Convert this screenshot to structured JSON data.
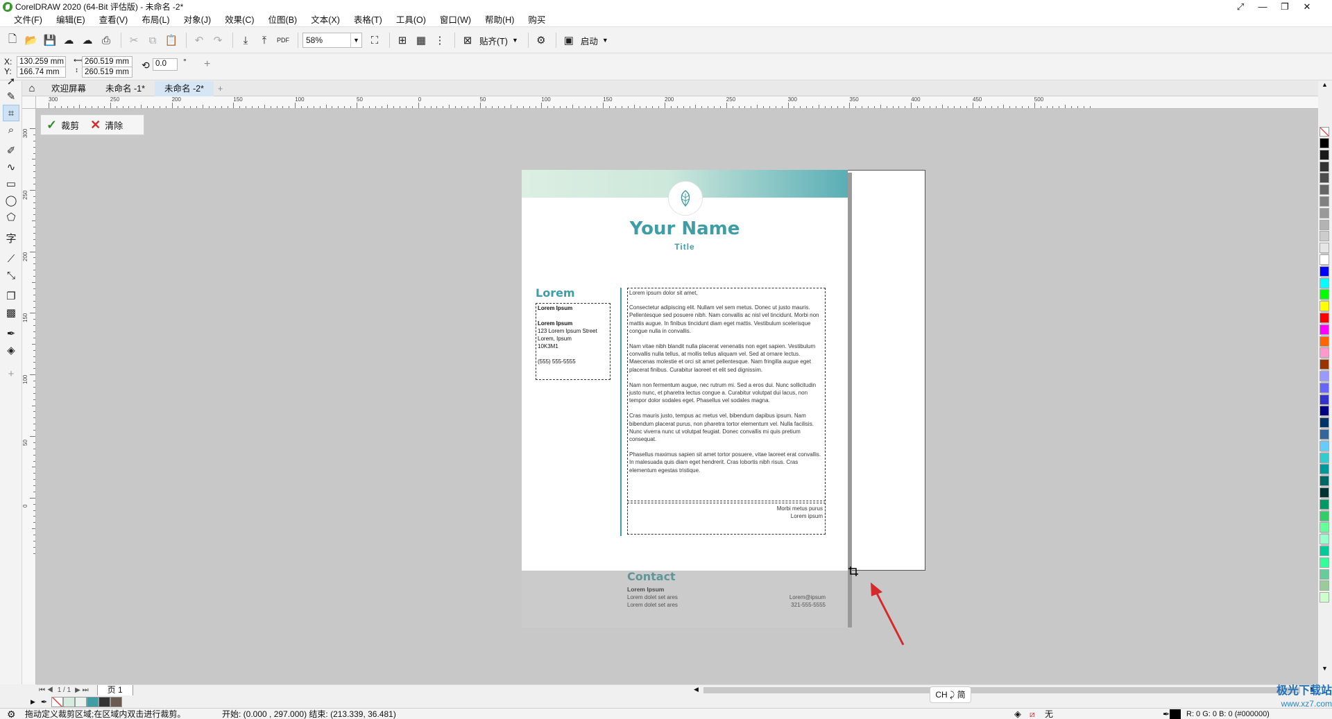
{
  "window": {
    "title": "CorelDRAW 2020 (64-Bit 评估版) - 未命名 -2*",
    "controls": [
      "⤢",
      "—",
      "❐",
      "✕"
    ]
  },
  "menu": [
    "文件(F)",
    "编辑(E)",
    "查看(V)",
    "布局(L)",
    "对象(J)",
    "效果(C)",
    "位图(B)",
    "文本(X)",
    "表格(T)",
    "工具(O)",
    "窗口(W)",
    "帮助(H)",
    "购买"
  ],
  "toolbar": {
    "zoom": "58%",
    "snap_label": "贴齐(T)",
    "launch_label": "启动",
    "pdf_label": "PDF"
  },
  "propbar": {
    "x_label": "X:",
    "y_label": "Y:",
    "x_value": "130.259 mm",
    "y_value": "166.74 mm",
    "w_value": "260.519 mm",
    "h_value": "260.519 mm",
    "rotation": "0.0",
    "degree_symbol": "°"
  },
  "doc_tabs": [
    "欢迎屏幕",
    "未命名 -1*",
    "未命名 -2*"
  ],
  "crop_bar": {
    "crop_label": "裁剪",
    "clear_label": "清除"
  },
  "document": {
    "name": "Your Name",
    "title": "Title",
    "left_heading": "Lorem",
    "left_box": {
      "line1": "Lorem Ipsum",
      "line2": "Lorem Ipsum",
      "line3": "123 Lorem Ipsum Street",
      "line4": "Lorem, Ipsum",
      "line5": "10K3M1",
      "line6": "(555) 555-5555"
    },
    "body": {
      "p1": "Lorem ipsum dolor sit amet,",
      "p2": "Consectetur adipiscing elit. Nullam vel sem metus. Donec ut justo mauris. Pellentesque sed posuere nibh. Nam convallis ac nisl vel tincidunt. Morbi non mattis augue. In finibus tincidunt diam eget mattis. Vestibulum scelerisque congue nulla in convallis.",
      "p3": "Nam vitae nibh blandit nulla placerat venenatis non eget sapien. Vestibulum convallis nulla tellus, at mollis tellus aliquam vel. Sed at ornare lectus. Maecenas molestie et orci sit amet pellentesque. Nam fringilla augue eget placerat finibus. Curabitur laoreet et elit sed dignissim.",
      "p4": "Nam non fermentum augue, nec rutrum mi. Sed a eros dui. Nunc sollicitudin justo nunc, et pharetra lectus congue a. Curabitur volutpat dui lacus, non tempor dolor sodales eget. Phasellus vel sodales magna.",
      "p5": "Cras mauris justo, tempus ac metus vel, bibendum dapibus ipsum. Nam bibendum placerat purus, non pharetra tortor elementum vel. Nulla facilisis. Nunc viverra nunc ut volutpat feugiat. Donec convallis mi quis pretium consequat.",
      "p6": "Phasellus maximus sapien sit amet tortor posuere, vitae laoreet erat convallis. In malesuada quis diam eget hendrerit. Cras lobortis nibh risus. Cras elementum egestas tristique."
    },
    "signature": {
      "line1": "Morbi metus purus",
      "line2": "Lorem ipsum"
    },
    "contact": {
      "heading": "Contact",
      "name": "Lorem Ipsum",
      "addr1": "Lorem dolet set ares",
      "addr2": "Lorem dolet set ares",
      "email": "Lorem@ipsum",
      "phone": "321-555-5555"
    }
  },
  "ruler": {
    "h_ticks": [
      "300",
      "250",
      "200",
      "150",
      "100",
      "50",
      "0",
      "50",
      "100",
      "150",
      "200",
      "250",
      "300",
      "350",
      "400",
      "450",
      "500"
    ],
    "v_ticks": [
      "300",
      "250",
      "200",
      "150",
      "100",
      "50",
      "0"
    ],
    "unit": "毫米"
  },
  "pagenav": {
    "counter": "1 / 1",
    "page_tab": "页 1"
  },
  "statusbar": {
    "hint": "拖动定义裁剪区域;在区域内双击进行裁剪。",
    "coords": "开始: (0.000 , 297.000)  结束: (213.339, 36.481)",
    "fill_label": "无",
    "color_info": "R: 0 G: 0 B: 0 (#000000)"
  },
  "ime": "CH ⤸ 简",
  "watermark": {
    "line1": "极光下载站",
    "line2": "www.xz7.com"
  },
  "colors": {
    "accent": "#3f9da5",
    "canvas": "#c8c8c8",
    "arrow": "#d42a2a",
    "palette": [
      "#000000",
      "#1a1a1a",
      "#333333",
      "#4d4d4d",
      "#666666",
      "#808080",
      "#999999",
      "#b3b3b3",
      "#cccccc",
      "#e6e6e6",
      "#ffffff",
      "#0000ff",
      "#00ffff",
      "#00ff00",
      "#ffff00",
      "#ff0000",
      "#ff00ff",
      "#ff6600",
      "#ff99cc",
      "#993300",
      "#9999ff",
      "#6666ff",
      "#3333cc",
      "#000080",
      "#003366",
      "#336699",
      "#66ccff",
      "#33cccc",
      "#009999",
      "#006666",
      "#003333",
      "#009966",
      "#33cc66",
      "#66ff99",
      "#99ffcc",
      "#00cc99",
      "#33ff99",
      "#66cc99",
      "#99cc99",
      "#ccffcc"
    ]
  }
}
